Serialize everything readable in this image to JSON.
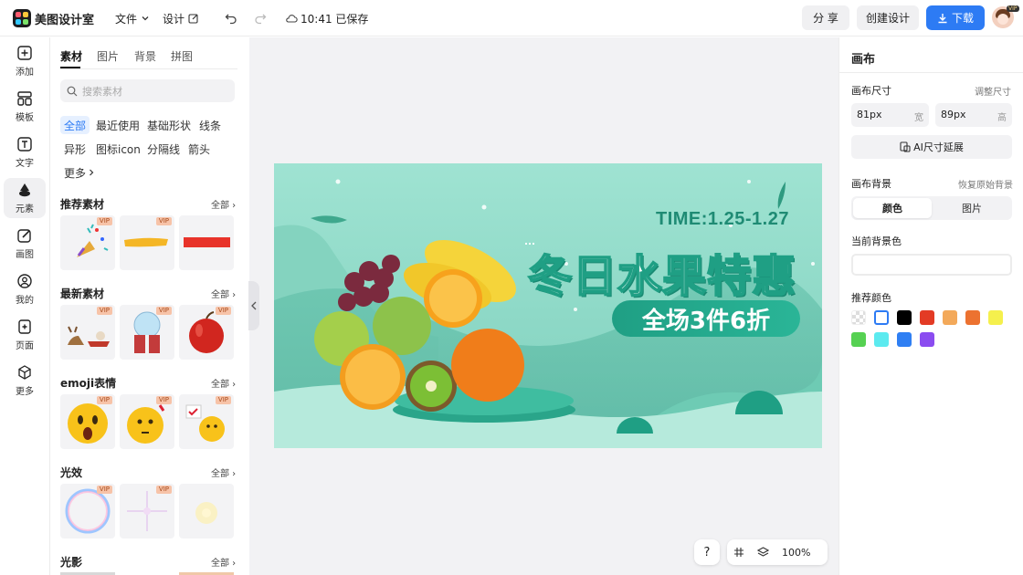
{
  "topbar": {
    "app_name": "美图设计室",
    "menu_file": "文件",
    "menu_design": "设计",
    "save_status": "10:41 已保存",
    "share_label": "分 享",
    "create_label": "创建设计",
    "download_label": "下载",
    "avatar_badge": "VIP",
    "brand_color": "#2d7bf4"
  },
  "rail": {
    "items": [
      {
        "label": "添加",
        "icon": "plus-square-icon"
      },
      {
        "label": "模板",
        "icon": "template-icon"
      },
      {
        "label": "文字",
        "icon": "text-icon"
      },
      {
        "label": "元素",
        "icon": "shapes-icon"
      },
      {
        "label": "画图",
        "icon": "pencil-icon"
      },
      {
        "label": "我的",
        "icon": "user-icon"
      },
      {
        "label": "页面",
        "icon": "page-add-icon"
      },
      {
        "label": "更多",
        "icon": "cube-icon"
      }
    ],
    "active_index": 3
  },
  "panel": {
    "tabs": [
      "素材",
      "图片",
      "背景",
      "拼图"
    ],
    "active_tab": 0,
    "search_placeholder": "搜索素材",
    "chips": [
      "全部",
      "最近使用",
      "基础形状",
      "线条",
      "异形",
      "图标icon",
      "分隔线",
      "箭头",
      "更多"
    ],
    "active_chip": 0,
    "all_label": "全部",
    "sections": [
      {
        "title": "推荐素材",
        "tiles": [
          "confetti",
          "yellow-brush",
          "red-bar"
        ],
        "vip": [
          true,
          true,
          false
        ]
      },
      {
        "title": "最新素材",
        "tiles": [
          "reindeer-sleigh",
          "snow-globe-gift",
          "apple"
        ],
        "vip": [
          true,
          true,
          true
        ]
      },
      {
        "title": "emoji表情",
        "tiles": [
          "shocked-emoji",
          "thinking-emoji",
          "chick-emoji"
        ],
        "vip": [
          true,
          true,
          true
        ]
      },
      {
        "title": "光效",
        "tiles": [
          "bubble",
          "sparkle",
          "glow"
        ],
        "vip": [
          true,
          true,
          false
        ]
      },
      {
        "title": "光影",
        "tiles": [],
        "vip": []
      }
    ],
    "vip_label": "VIP"
  },
  "canvas": {
    "time_text": "TIME:1.25-1.27",
    "headline": "冬日水果特惠",
    "sub_headline": "全场3件6折",
    "bg_color": "#8fd8c6"
  },
  "props": {
    "title": "画布",
    "size_label": "画布尺寸",
    "adjust_size": "调整尺寸",
    "width_value": "81px",
    "width_unit": "宽",
    "height_value": "89px",
    "height_unit": "高",
    "ai_expand": "AI尺寸延展",
    "bg_label": "画布背景",
    "restore_bg": "恢复原始背景",
    "bg_tabs": [
      "颜色",
      "图片"
    ],
    "current_bg_label": "当前背景色",
    "current_bg_value": "",
    "recommended_label": "推荐颜色",
    "swatches": [
      "transparent",
      "#ffffff",
      "#000000",
      "#e33b25",
      "#f3a95a",
      "#ec7230",
      "#f5f04d",
      "#56d152",
      "#5ceaef",
      "#2f7ff3",
      "#8b4cf0"
    ]
  },
  "zoom": {
    "help": "?",
    "level": "100%"
  }
}
